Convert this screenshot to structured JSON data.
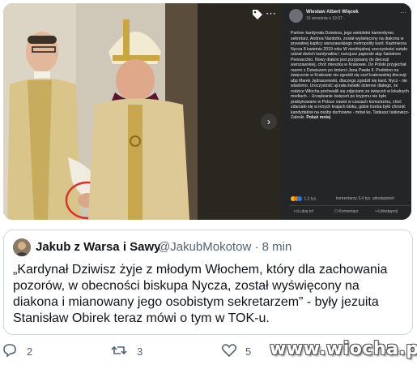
{
  "facebook_post": {
    "author": "Wiesław Albert Więcek",
    "date": "16 września o 19:37 ·",
    "text": "Partner kardynała Dziwisza, jego wieloletni kamerdyner, sekretarz, Andrea Nardotto, został wyświęcony na diakona w prywatnej kaplicy warszawskiego metropolity kard. Kazimierza Nycza 8 kwietnia 2019 roku W nieoficjalnej uroczystości wzięło udział dwóch kardynałów i nuncjusz papieski abp Salvatore Pennacchio. Nowy diakon jest przypisany do diecezji warszawskiej, choć mieszka w Krakowie. Do Polski przyjechał razem z Dziwiszem po śmierci Jana Pawła II. Podobno na święcenie w Krakowie nie zgodził się szef krakowskiej diecezji abp Marek Jędraszewski, dlaczego zgodził się kard. Nycz - nie wiadomo. Uroczystość ujrzała światło dzienne dlatego, że rodzice Włocha pochwalili się zdjęciami ze święceń w lokalnych mediach. - Urządzanie święceń po kryjomu nie było praktykowane w Polsce nawet w czasach komunizmu, choć zdarzało się w innych krajach bloku, gdzie trzeba było chronić kandydatów na osoby duchowne - mówi ks. Tadeusz Isakowicz-Zaleski.",
    "more_label": "Pokaż mniej",
    "reactions_count": "1,3 tys.",
    "stats": "komentarzy 3,4 tys. udostępnień",
    "like_label": "Lubię to!",
    "comment_label": "Komentarz",
    "share_label": "Udostępnij"
  },
  "tweet": {
    "display_name": "Jakub z Warsa i Sawy",
    "handle": "@JakubMokotow · 8 min",
    "text": "„Kardynał Dziwisz żyje z młodym Włochem, który dla zachowania pozorów, w obecności biskupa Nycza, został wyświęcony na diakona i mianowany jego osobistym sekretarzem” - były jezuita Stanisław Obirek teraz mówi o tym w TOK-u."
  },
  "actions": {
    "replies": "2",
    "retweets": "3",
    "likes": "5"
  },
  "watermark": "www.wiocha.pl",
  "colors": {
    "fb_dark": "#242526",
    "tweet_border": "#cfd9de",
    "text_primary": "#0f1419",
    "text_secondary": "#536471"
  }
}
